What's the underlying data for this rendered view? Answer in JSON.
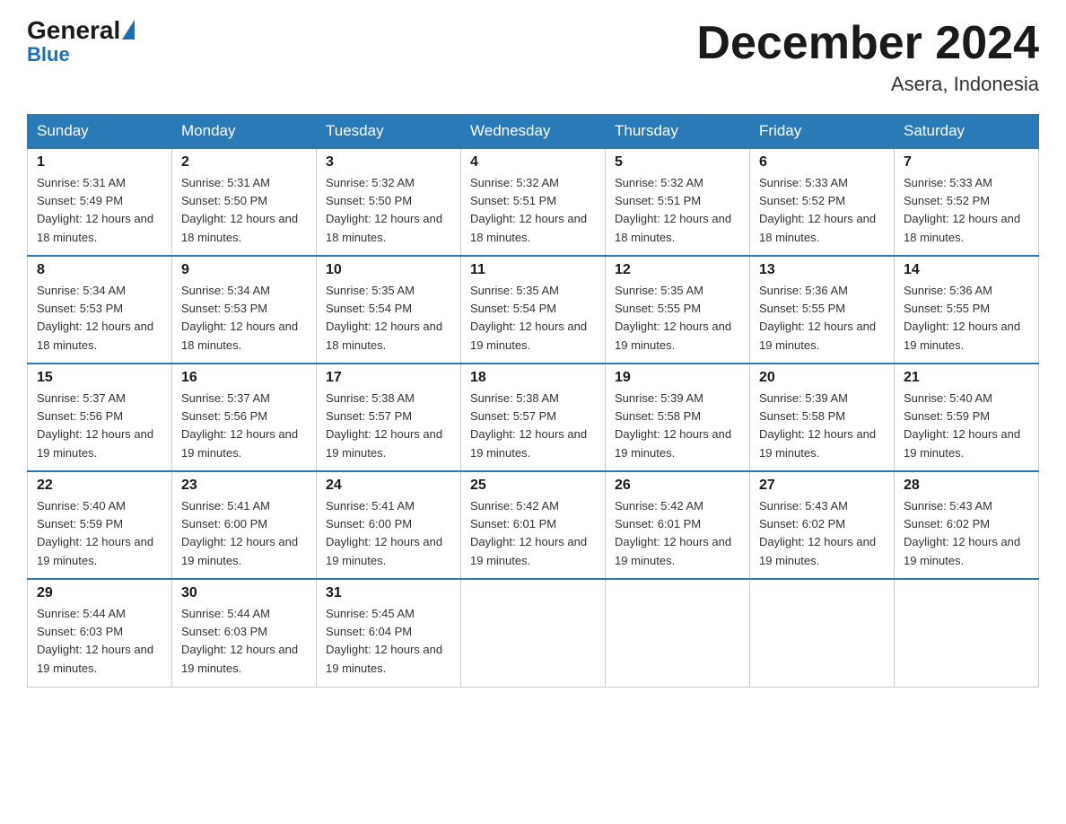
{
  "logo": {
    "general": "General",
    "triangle": "▲",
    "blue": "Blue"
  },
  "header": {
    "month_title": "December 2024",
    "location": "Asera, Indonesia"
  },
  "days_of_week": [
    "Sunday",
    "Monday",
    "Tuesday",
    "Wednesday",
    "Thursday",
    "Friday",
    "Saturday"
  ],
  "weeks": [
    [
      {
        "day": "1",
        "sunrise": "5:31 AM",
        "sunset": "5:49 PM",
        "daylight": "12 hours and 18 minutes."
      },
      {
        "day": "2",
        "sunrise": "5:31 AM",
        "sunset": "5:50 PM",
        "daylight": "12 hours and 18 minutes."
      },
      {
        "day": "3",
        "sunrise": "5:32 AM",
        "sunset": "5:50 PM",
        "daylight": "12 hours and 18 minutes."
      },
      {
        "day": "4",
        "sunrise": "5:32 AM",
        "sunset": "5:51 PM",
        "daylight": "12 hours and 18 minutes."
      },
      {
        "day": "5",
        "sunrise": "5:32 AM",
        "sunset": "5:51 PM",
        "daylight": "12 hours and 18 minutes."
      },
      {
        "day": "6",
        "sunrise": "5:33 AM",
        "sunset": "5:52 PM",
        "daylight": "12 hours and 18 minutes."
      },
      {
        "day": "7",
        "sunrise": "5:33 AM",
        "sunset": "5:52 PM",
        "daylight": "12 hours and 18 minutes."
      }
    ],
    [
      {
        "day": "8",
        "sunrise": "5:34 AM",
        "sunset": "5:53 PM",
        "daylight": "12 hours and 18 minutes."
      },
      {
        "day": "9",
        "sunrise": "5:34 AM",
        "sunset": "5:53 PM",
        "daylight": "12 hours and 18 minutes."
      },
      {
        "day": "10",
        "sunrise": "5:35 AM",
        "sunset": "5:54 PM",
        "daylight": "12 hours and 18 minutes."
      },
      {
        "day": "11",
        "sunrise": "5:35 AM",
        "sunset": "5:54 PM",
        "daylight": "12 hours and 19 minutes."
      },
      {
        "day": "12",
        "sunrise": "5:35 AM",
        "sunset": "5:55 PM",
        "daylight": "12 hours and 19 minutes."
      },
      {
        "day": "13",
        "sunrise": "5:36 AM",
        "sunset": "5:55 PM",
        "daylight": "12 hours and 19 minutes."
      },
      {
        "day": "14",
        "sunrise": "5:36 AM",
        "sunset": "5:55 PM",
        "daylight": "12 hours and 19 minutes."
      }
    ],
    [
      {
        "day": "15",
        "sunrise": "5:37 AM",
        "sunset": "5:56 PM",
        "daylight": "12 hours and 19 minutes."
      },
      {
        "day": "16",
        "sunrise": "5:37 AM",
        "sunset": "5:56 PM",
        "daylight": "12 hours and 19 minutes."
      },
      {
        "day": "17",
        "sunrise": "5:38 AM",
        "sunset": "5:57 PM",
        "daylight": "12 hours and 19 minutes."
      },
      {
        "day": "18",
        "sunrise": "5:38 AM",
        "sunset": "5:57 PM",
        "daylight": "12 hours and 19 minutes."
      },
      {
        "day": "19",
        "sunrise": "5:39 AM",
        "sunset": "5:58 PM",
        "daylight": "12 hours and 19 minutes."
      },
      {
        "day": "20",
        "sunrise": "5:39 AM",
        "sunset": "5:58 PM",
        "daylight": "12 hours and 19 minutes."
      },
      {
        "day": "21",
        "sunrise": "5:40 AM",
        "sunset": "5:59 PM",
        "daylight": "12 hours and 19 minutes."
      }
    ],
    [
      {
        "day": "22",
        "sunrise": "5:40 AM",
        "sunset": "5:59 PM",
        "daylight": "12 hours and 19 minutes."
      },
      {
        "day": "23",
        "sunrise": "5:41 AM",
        "sunset": "6:00 PM",
        "daylight": "12 hours and 19 minutes."
      },
      {
        "day": "24",
        "sunrise": "5:41 AM",
        "sunset": "6:00 PM",
        "daylight": "12 hours and 19 minutes."
      },
      {
        "day": "25",
        "sunrise": "5:42 AM",
        "sunset": "6:01 PM",
        "daylight": "12 hours and 19 minutes."
      },
      {
        "day": "26",
        "sunrise": "5:42 AM",
        "sunset": "6:01 PM",
        "daylight": "12 hours and 19 minutes."
      },
      {
        "day": "27",
        "sunrise": "5:43 AM",
        "sunset": "6:02 PM",
        "daylight": "12 hours and 19 minutes."
      },
      {
        "day": "28",
        "sunrise": "5:43 AM",
        "sunset": "6:02 PM",
        "daylight": "12 hours and 19 minutes."
      }
    ],
    [
      {
        "day": "29",
        "sunrise": "5:44 AM",
        "sunset": "6:03 PM",
        "daylight": "12 hours and 19 minutes."
      },
      {
        "day": "30",
        "sunrise": "5:44 AM",
        "sunset": "6:03 PM",
        "daylight": "12 hours and 19 minutes."
      },
      {
        "day": "31",
        "sunrise": "5:45 AM",
        "sunset": "6:04 PM",
        "daylight": "12 hours and 19 minutes."
      },
      null,
      null,
      null,
      null
    ]
  ]
}
